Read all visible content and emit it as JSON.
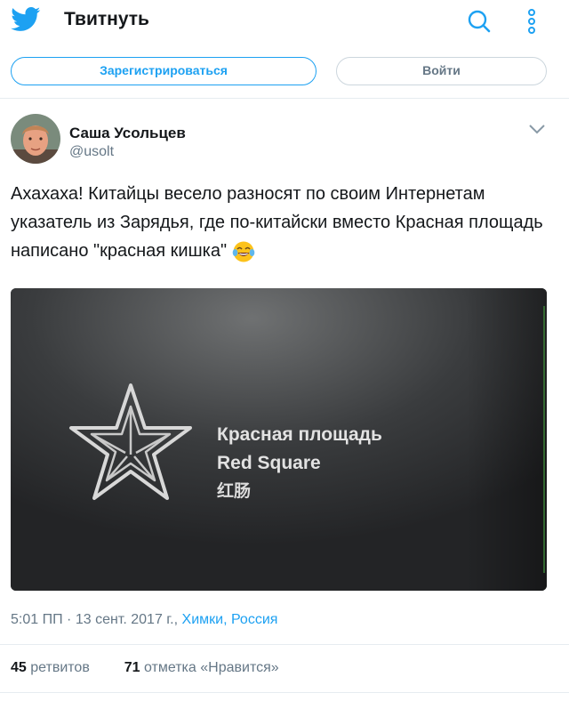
{
  "header": {
    "title": "Твитнуть",
    "logo": "twitter-bird-icon",
    "actions": [
      "search-icon",
      "more-vertical-icon"
    ]
  },
  "auth": {
    "signup_label": "Зарегистрироваться",
    "login_label": "Войти"
  },
  "tweet": {
    "author_name": "Саша Усольцев",
    "author_handle": "@usolt",
    "text": "Ахахаха! Китайцы весело разносят по своим Интернетам указатель из Зарядья, где по-китайски вместо Красная площадь написано \"красная кишка\"",
    "emoji": "face-with-tears-of-joy",
    "image": {
      "line1": "Красная площадь",
      "line2": "Red Square",
      "line3": "红肠"
    },
    "time": "5:01 ПП",
    "date_separator": "·",
    "date": "13 сент. 2017 г.,",
    "location": "Химки, Россия",
    "retweets_count": "45",
    "retweets_label": "ретвитов",
    "likes_count": "71",
    "likes_label": "отметка «Нравится»"
  },
  "colors": {
    "accent": "#1da1f2",
    "text": "#14171a",
    "muted": "#657786",
    "divider": "#e6ecf0"
  }
}
